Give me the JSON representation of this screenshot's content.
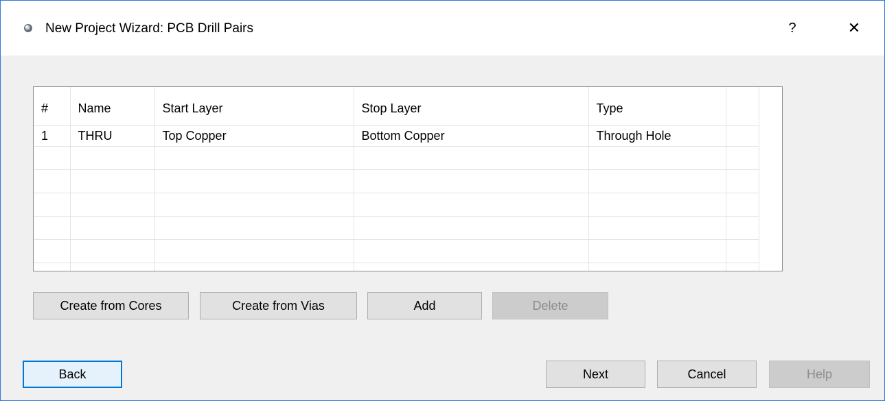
{
  "window": {
    "title": "New Project Wizard: PCB Drill Pairs",
    "help_glyph": "?",
    "close_glyph": "✕",
    "accent_color": "#2b79d6"
  },
  "grid": {
    "columns": [
      "#",
      "Name",
      "Start Layer",
      "Stop Layer",
      "Type"
    ],
    "rows": [
      [
        "1",
        "THRU",
        "Top Copper",
        "Bottom Copper",
        "Through Hole"
      ]
    ]
  },
  "actions": {
    "create_from_cores": "Create from Cores",
    "create_from_vias": "Create from Vias",
    "add": "Add",
    "delete": "Delete"
  },
  "footer": {
    "back": "Back",
    "next": "Next",
    "cancel": "Cancel",
    "help": "Help"
  }
}
